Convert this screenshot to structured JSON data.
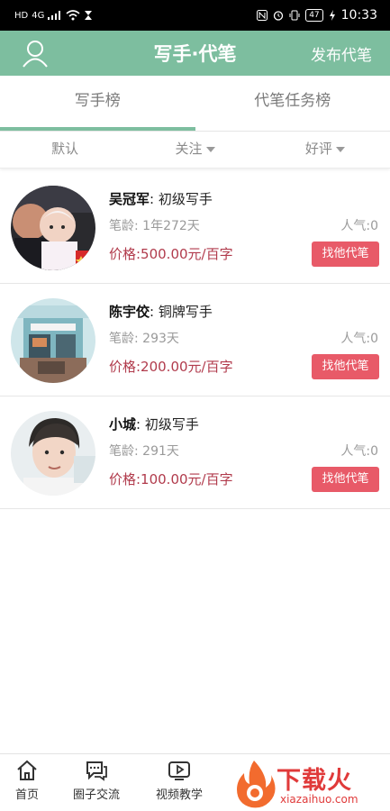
{
  "status_bar": {
    "left_label": "HD",
    "network": "4G",
    "battery": "47",
    "time": "10:33"
  },
  "header": {
    "title": "写手·代笔",
    "publish_label": "发布代笔"
  },
  "tabs": [
    {
      "label": "写手榜",
      "active": true
    },
    {
      "label": "代笔任务榜",
      "active": false
    }
  ],
  "filters": [
    {
      "label": "默认",
      "has_caret": false
    },
    {
      "label": "关注",
      "has_caret": true
    },
    {
      "label": "好评",
      "has_caret": true
    }
  ],
  "writers": [
    {
      "name": "吴冠军",
      "level": ": 初级写手",
      "age_label": "笔龄:",
      "age": "1年272天",
      "popularity": "人气:0",
      "price": "价格:500.00元/百字",
      "button": "找他代笔"
    },
    {
      "name": "陈宇佼",
      "level": ": 铜牌写手",
      "age_label": "笔龄:",
      "age": "293天",
      "popularity": "人气:0",
      "price": "价格:200.00元/百字",
      "button": "找他代笔"
    },
    {
      "name": "小城",
      "level": ": 初级写手",
      "age_label": "笔龄:",
      "age": "291天",
      "popularity": "人气:0",
      "price": "价格:100.00元/百字",
      "button": "找他代笔"
    }
  ],
  "bottom_nav": [
    {
      "label": "首页",
      "icon": "home-icon"
    },
    {
      "label": "圈子交流",
      "icon": "chat-icon"
    },
    {
      "label": "视频教学",
      "icon": "video-icon"
    }
  ],
  "watermark": {
    "text": "下载火",
    "sub": "xiazaihuo.com"
  },
  "colors": {
    "brand_green": "#7dbe9f",
    "price_red": "#b13b4c",
    "button_red": "#e85a68"
  }
}
